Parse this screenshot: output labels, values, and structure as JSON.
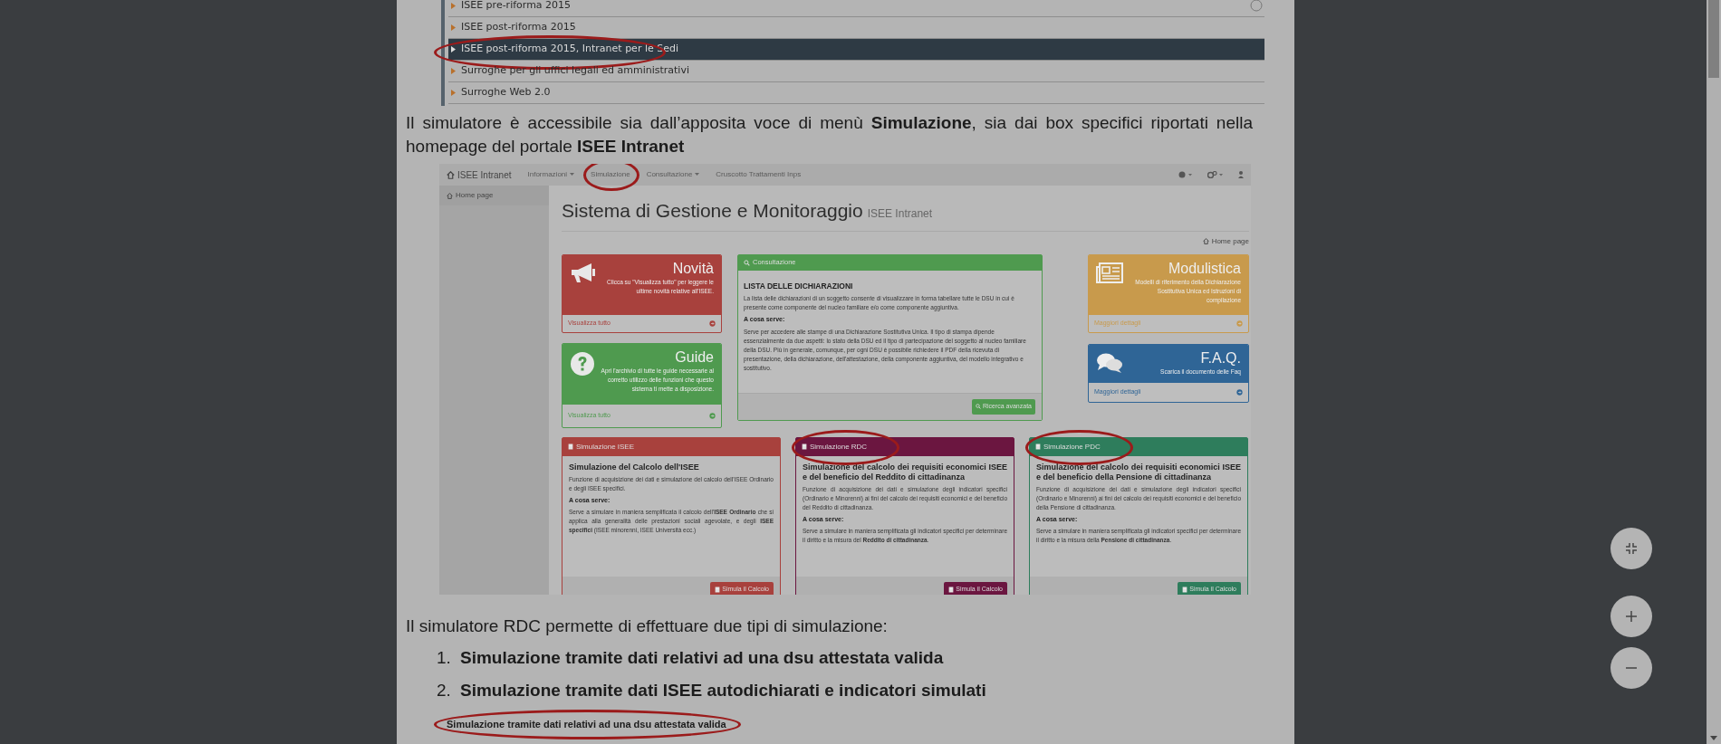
{
  "document": {
    "menu_items": [
      {
        "label": "ISEE pre-riforma 2015",
        "selected": false,
        "circled": false
      },
      {
        "label": "ISEE post-riforma 2015",
        "selected": false,
        "circled": false
      },
      {
        "label": "ISEE post-riforma 2015, Intranet per le Sedi",
        "selected": true,
        "circled": true
      },
      {
        "label": "Surroghe per gli uffici legali ed amministrativi",
        "selected": false,
        "circled": false
      },
      {
        "label": "Surroghe Web 2.0",
        "selected": false,
        "circled": false
      }
    ],
    "paragraph_1": "Il simulatore è accessibile sia dall’apposita voce di menù **Simulazione**, sia dai box specifici riportati nella homepage del portale **ISEE Intranet**",
    "screenshot": {
      "brand": "ISEE Intranet",
      "nav": [
        {
          "label": "Informazioni",
          "dropdown": true,
          "circled": false
        },
        {
          "label": "Simulazione",
          "dropdown": false,
          "circled": true
        },
        {
          "label": "Consultazione",
          "dropdown": true,
          "circled": false
        },
        {
          "label": "Cruscotto Trattamenti Inps",
          "dropdown": false,
          "circled": false
        }
      ],
      "sidebar_item": "Home page",
      "title": "Sistema di Gestione e Monitoraggio",
      "subtitle": "ISEE Intranet",
      "breadcrumb": "Home page",
      "tiles": [
        {
          "kind": "megaphone",
          "title": "Novità",
          "text": "Clicca su \"Visualizza tutto\" per leggere le ultime novità relative all'ISEE.",
          "link": "Visualizza tutto",
          "color": "#a8413d"
        },
        {
          "kind": "question",
          "title": "Guide",
          "text": "Apri l'archivio di tutte le guide necessarie al corretto utilizzo delle funzioni che questo sistema ti mette a disposizione.",
          "link": "Visualizza tutto",
          "color": "#4f9a4f"
        },
        {
          "kind": "newspaper",
          "title": "Modulistica",
          "text": "Modelli di riferimento della Dichiarazione Sostitutiva Unica ed Istruzioni di compilazione",
          "link": "Maggiori dettagli",
          "color": "#c89a4c"
        },
        {
          "kind": "comments",
          "title": "F.A.Q.",
          "text": "Scarica il documento delle Faq",
          "link": "Maggiori dettagli",
          "color": "#2f6596"
        }
      ],
      "consultazione": {
        "header": "Consultazione",
        "heading": "LISTA DELLE DICHIARAZIONI",
        "text": "La lista delle dichiarazioni di un soggetto consente di visualizzare in forma tabellare tutte le DSU in cui è presente come componente del nucleo familiare e/o come componente aggiuntiva.",
        "subheading": "A cosa serve:",
        "text_2": "Serve per accedere alle stampe di una Dichiarazione Sostitutiva Unica. Il tipo di stampa dipende essenzialmente da due aspetti: lo stato della DSU ed il tipo di partecipazione del soggetto al nucleo familiare della DSU. Più in generale, comunque, per ogni DSU è possibile richiedere il PDF della ricevuta di presentazione, della dichiarazione, dell'attestazione, della componente aggiuntiva, del modello integrativo e sostitutivo.",
        "button": "Ricerca avanzata"
      },
      "sim_cards": [
        {
          "header": "Simulazione ISEE",
          "color": "#a8413d",
          "circled": false,
          "heading": "Simulazione del Calcolo dell'ISEE",
          "text": "Funzione di acquisizione dei dati e simulazione del calcolo dell'ISEE Ordinario e degli ISEE specifici.",
          "subheading": "A cosa serve:",
          "text_2": "Serve a simulare in maniera semplificata il calcolo dell'**ISEE Ordinario** che si applica alla generalità delle prestazioni sociali agevolate, e degli **ISEE specifici** (ISEE minorenni, ISEE Università ecc.)",
          "button": "Simula il Calcolo"
        },
        {
          "header": "Simulazione RDC",
          "color": "#6b1640",
          "circled": true,
          "heading": "Simulazione del calcolo dei requisiti economici ISEE e del beneficio del Reddito di cittadinanza",
          "text": "Funzione di acquisizione dei dati e simulazione degli indicatori specifici (Ordinario e Minorenni) ai fini del calcolo dei requisiti economici e del beneficio del Reddito di cittadinanza.",
          "subheading": "A cosa serve:",
          "text_2": "Serve a simulare in maniera semplificata gli indicatori specifici per determinare il diritto e la misura del **Reddito di cittadinanza**.",
          "button": "Simula il Calcolo"
        },
        {
          "header": "Simulazione PDC",
          "color": "#2e7d5c",
          "circled": true,
          "heading": "Simulazione del calcolo dei requisiti economici ISEE e del beneficio della Pensione di cittadinanza",
          "text": "Funzione di acquisizione dei dati e simulazione degli indicatori specifici (Ordinario e Minorenni) ai fini del calcolo dei requisiti economici e del beneficio della Pensione di cittadinanza.",
          "subheading": "A cosa serve:",
          "text_2": "Serve a simulare in maniera semplificata gli indicatori specifici per determinare il diritto e la misura della **Pensione di cittadinanza**.",
          "button": "Simula il Calcolo"
        }
      ]
    },
    "paragraph_2": "Il simulatore RDC permette di effettuare due tipi di simulazione:",
    "list": [
      {
        "number": "1.",
        "text": "Simulazione tramite dati relativi ad una dsu attestata valida"
      },
      {
        "number": "2.",
        "text": "Simulazione tramite dati ISEE autodichiarati e indicatori simulati"
      }
    ],
    "cut_heading": {
      "text": "Simulazione tramite dati relativi ad una dsu attestata valida",
      "circled": true
    }
  },
  "viewer_controls": [
    {
      "kind": "fit"
    },
    {
      "kind": "zoom_in"
    },
    {
      "kind": "zoom_out"
    }
  ]
}
